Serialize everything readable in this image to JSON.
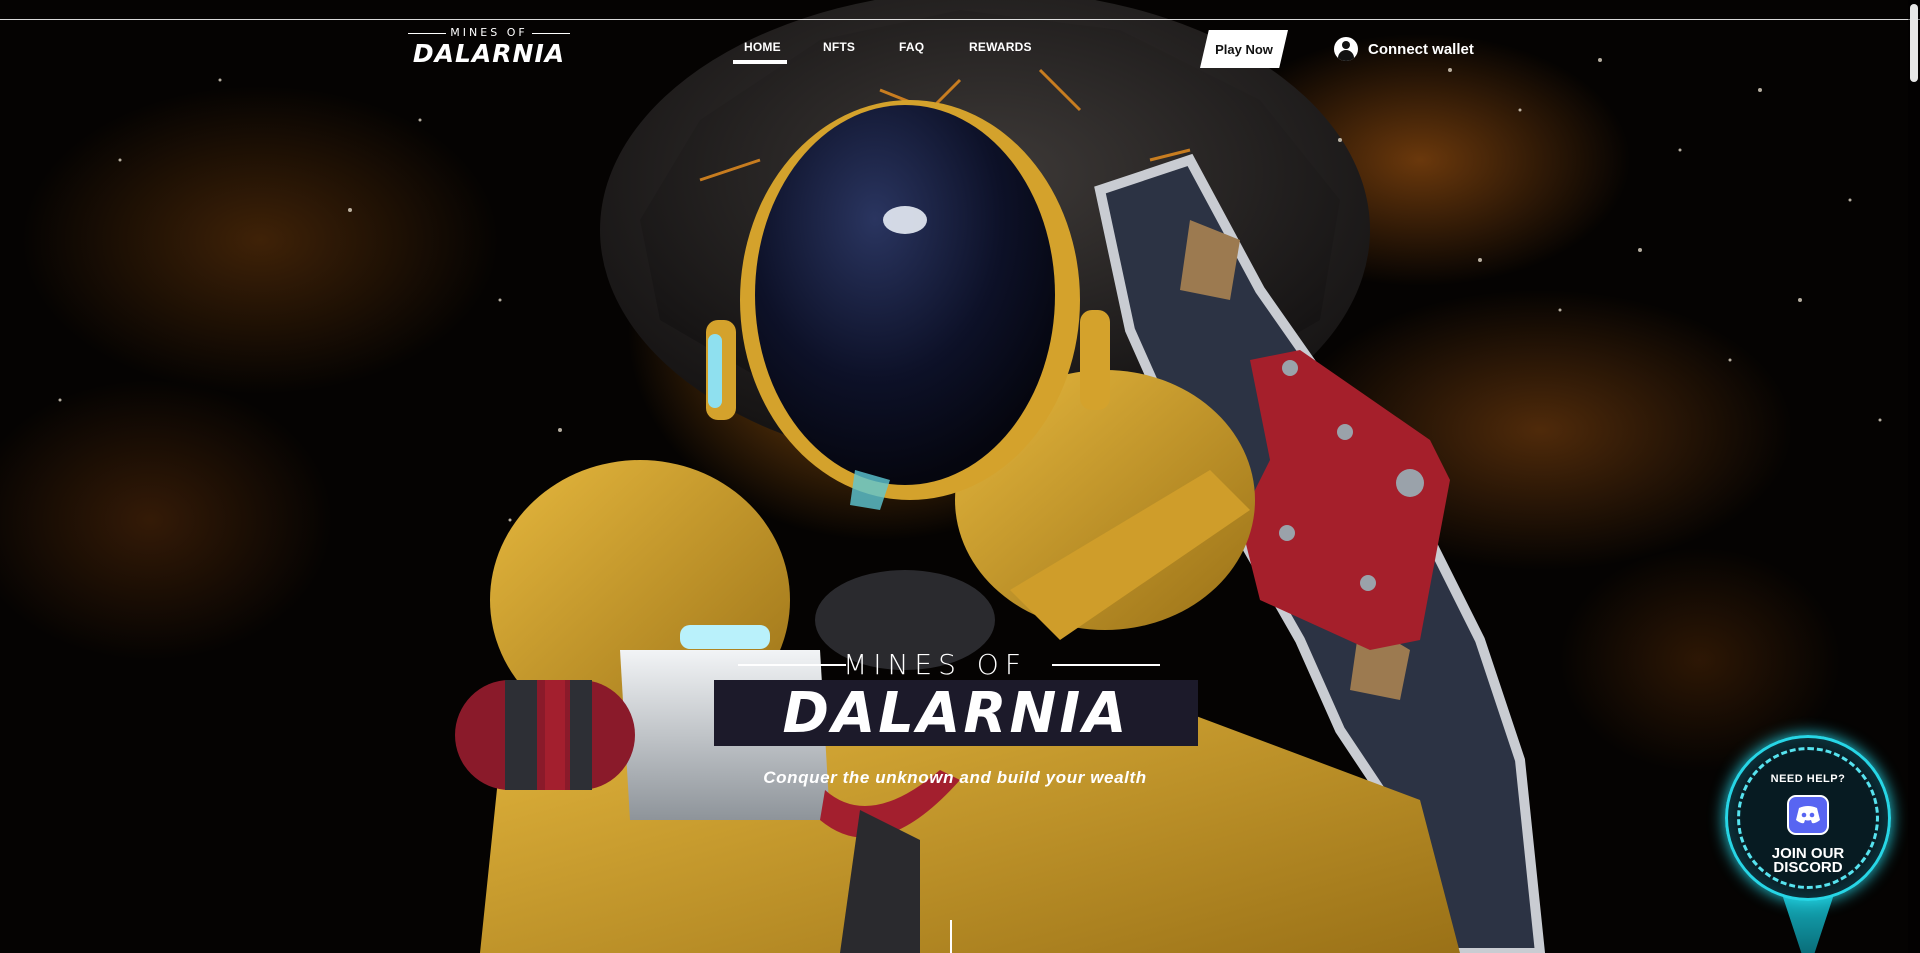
{
  "header": {
    "logo_small": "MINES OF",
    "logo_big": "DALARNIA",
    "nav": [
      {
        "label": "HOME",
        "active": true
      },
      {
        "label": "NFTS",
        "active": false
      },
      {
        "label": "FAQ",
        "active": false
      },
      {
        "label": "REWARDS",
        "active": false
      }
    ],
    "play_label": "Play Now",
    "wallet_label": "Connect wallet"
  },
  "hero": {
    "title_small": "MINES OF",
    "title_big": "DALARNIA",
    "tagline": "Conquer the unknown and build your wealth"
  },
  "discord": {
    "help_label": "NEED HELP?",
    "join_line1": "JOIN OUR",
    "join_line2": "DISCORD",
    "icon": "discord-icon"
  },
  "colors": {
    "accent_gold": "#d4a22c",
    "discord_cyan": "#27d6e6",
    "discord_blurple": "#5865f2"
  }
}
